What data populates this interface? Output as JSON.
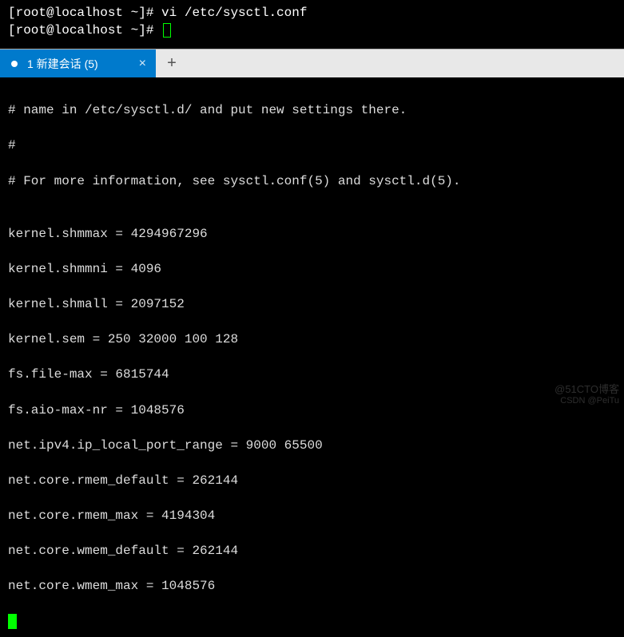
{
  "top_terminal": {
    "prompt1": "[root@localhost ~]# ",
    "command1": "vi /etc/sysctl.conf",
    "prompt2": "[root@localhost ~]# "
  },
  "tab": {
    "label": "1 新建会话 (5)",
    "close": "×",
    "add": "+"
  },
  "body": {
    "line1": "# name in /etc/sysctl.d/ and put new settings there.",
    "line2": "#",
    "line3": "# For more information, see sysctl.conf(5) and sysctl.d(5).",
    "blank": "",
    "kv1": "kernel.shmmax = 4294967296",
    "kv2": "kernel.shmmni = 4096",
    "kv3": "kernel.shmall = 2097152",
    "kv4": "kernel.sem = 250 32000 100 128",
    "kv5": "fs.file-max = 6815744",
    "kv6": "fs.aio-max-nr = 1048576",
    "kv7": "net.ipv4.ip_local_port_range = 9000 65500",
    "kv8": "net.core.rmem_default = 262144",
    "kv9": "net.core.rmem_max = 4194304",
    "kv10": "net.core.wmem_default = 262144",
    "kv11": "net.core.wmem_max = 1048576"
  },
  "watermark": {
    "main": "@51CTO博客",
    "sub": "CSDN @PeiTu"
  }
}
